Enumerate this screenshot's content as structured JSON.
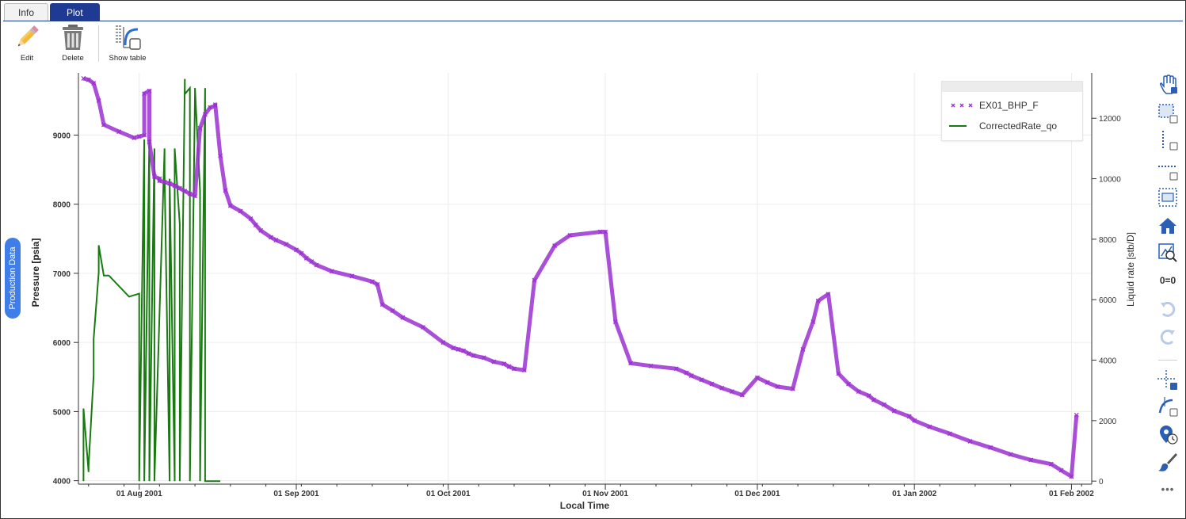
{
  "tabs": [
    {
      "label": "Info",
      "active": false
    },
    {
      "label": "Plot",
      "active": true
    }
  ],
  "toolbar": {
    "edit_label": "Edit",
    "delete_label": "Delete",
    "show_table_label": "Show table"
  },
  "side_tab": {
    "label": "Production Data"
  },
  "right_toolbar": {
    "icons": [
      "pan-icon",
      "box-zoom-icon",
      "x-zoom-icon",
      "y-zoom-icon",
      "zoom-both-icon",
      "reset-home-icon",
      "zoom-to-fit-icon",
      "zero-zero-icon",
      "undo-icon",
      "redo-icon",
      "crosshair-icon",
      "curve-select-icon",
      "hover-tooltip-icon",
      "paint-brush-icon",
      "more-icon"
    ],
    "zero_label": "0=0",
    "more_label": "•••"
  },
  "colors": {
    "accent": "#1f3a93",
    "pressure_series": "#9b30d0",
    "rate_series": "#1a7a12",
    "side_pill": "#3f7ee8"
  },
  "chart_data": {
    "type": "line",
    "xlabel": "Local Time",
    "ylabel": "Pressure [psia]",
    "y2label": "Liquid rate [stb/D]",
    "xlim": [
      "2001-07-20",
      "2002-02-05"
    ],
    "ylim": [
      3950,
      9900
    ],
    "y2lim": [
      -100,
      13500
    ],
    "x_ticks": [
      {
        "date": "2001-08-01",
        "label": "01 Aug 2001"
      },
      {
        "date": "2001-09-01",
        "label": "01 Sep 2001"
      },
      {
        "date": "2001-10-01",
        "label": "01 Oct 2001"
      },
      {
        "date": "2001-11-01",
        "label": "01 Nov 2001"
      },
      {
        "date": "2001-12-01",
        "label": "01 Dec 2001"
      },
      {
        "date": "2002-01-01",
        "label": "01 Jan 2002"
      },
      {
        "date": "2002-02-01",
        "label": "01 Feb 2002"
      }
    ],
    "y_ticks": [
      4000,
      5000,
      6000,
      7000,
      8000,
      9000
    ],
    "y2_ticks": [
      0,
      2000,
      4000,
      6000,
      8000,
      10000,
      12000
    ],
    "grid": true,
    "legend_position": "top-right",
    "series": [
      {
        "name": "EX01_BHP_F",
        "axis": "left",
        "style": "x-markers",
        "x": [
          "2001-07-21",
          "2001-07-22",
          "2001-07-23",
          "2001-07-24",
          "2001-07-25",
          "2001-07-28",
          "2001-07-31",
          "2001-08-01",
          "2001-08-02",
          "2001-08-02",
          "2001-08-03",
          "2001-08-03",
          "2001-08-04",
          "2001-08-05",
          "2001-08-05",
          "2001-08-06",
          "2001-08-07",
          "2001-08-08",
          "2001-08-09",
          "2001-08-10",
          "2001-08-11",
          "2001-08-12",
          "2001-08-13",
          "2001-08-14",
          "2001-08-15",
          "2001-08-16",
          "2001-08-16",
          "2001-08-17",
          "2001-08-18",
          "2001-08-19",
          "2001-08-21",
          "2001-08-23",
          "2001-08-24",
          "2001-08-25",
          "2001-08-27",
          "2001-08-28",
          "2001-08-30",
          "2001-09-01",
          "2001-09-02",
          "2001-09-03",
          "2001-09-04",
          "2001-09-05",
          "2001-09-08",
          "2001-09-12",
          "2001-09-16",
          "2001-09-17",
          "2001-09-18",
          "2001-09-20",
          "2001-09-22",
          "2001-09-26",
          "2001-09-30",
          "2001-10-02",
          "2001-10-03",
          "2001-10-04",
          "2001-10-05",
          "2001-10-06",
          "2001-10-08",
          "2001-10-10",
          "2001-10-12",
          "2001-10-13",
          "2001-10-14",
          "2001-10-16",
          "2001-10-18",
          "2001-10-22",
          "2001-10-25",
          "2001-10-31",
          "2001-11-01",
          "2001-11-03",
          "2001-11-06",
          "2001-11-10",
          "2001-11-15",
          "2001-11-17",
          "2001-11-18",
          "2001-11-20",
          "2001-11-22",
          "2001-11-24",
          "2001-11-26",
          "2001-11-28",
          "2001-12-01",
          "2001-12-03",
          "2001-12-05",
          "2001-12-08",
          "2001-12-10",
          "2001-12-12",
          "2001-12-13",
          "2001-12-15",
          "2001-12-17",
          "2001-12-19",
          "2001-12-21",
          "2001-12-23",
          "2001-12-24",
          "2001-12-26",
          "2001-12-28",
          "2001-12-31",
          "2002-01-01",
          "2002-01-04",
          "2002-01-08",
          "2002-01-12",
          "2002-01-16",
          "2002-01-20",
          "2002-01-24",
          "2002-01-28",
          "2002-01-30",
          "2002-02-01",
          "2002-02-02"
        ],
        "y": [
          9820,
          9800,
          9750,
          9500,
          9150,
          9050,
          8960,
          8980,
          9000,
          9600,
          9640,
          8900,
          8400,
          8370,
          8340,
          8320,
          8300,
          8270,
          8230,
          8190,
          8150,
          8120,
          9100,
          9300,
          9400,
          9420,
          9440,
          8700,
          8200,
          7980,
          7900,
          7790,
          7700,
          7620,
          7520,
          7480,
          7420,
          7340,
          7290,
          7220,
          7170,
          7120,
          7030,
          6960,
          6880,
          6840,
          6550,
          6460,
          6360,
          6220,
          6000,
          5920,
          5900,
          5880,
          5840,
          5810,
          5780,
          5720,
          5690,
          5650,
          5620,
          5600,
          6900,
          7400,
          7550,
          7600,
          7600,
          6300,
          5700,
          5660,
          5620,
          5560,
          5520,
          5460,
          5400,
          5340,
          5290,
          5240,
          5490,
          5420,
          5360,
          5330,
          5900,
          6300,
          6600,
          6700,
          5550,
          5400,
          5290,
          5230,
          5170,
          5100,
          5010,
          4930,
          4870,
          4780,
          4680,
          4570,
          4480,
          4380,
          4300,
          4240,
          4150,
          4060,
          4950
        ]
      },
      {
        "name": "CorrectedRate_qo",
        "axis": "right",
        "style": "step-line",
        "x": [
          "2001-07-21",
          "2001-07-21",
          "2001-07-22",
          "2001-07-22",
          "2001-07-23",
          "2001-07-23",
          "2001-07-24",
          "2001-07-24",
          "2001-07-25",
          "2001-07-25",
          "2001-07-26",
          "2001-07-26",
          "2001-07-30",
          "2001-07-30",
          "2001-08-01",
          "2001-08-01",
          "2001-08-02",
          "2001-08-02",
          "2001-08-03",
          "2001-08-03",
          "2001-08-04",
          "2001-08-04",
          "2001-08-06",
          "2001-08-06",
          "2001-08-07",
          "2001-08-07",
          "2001-08-08",
          "2001-08-08",
          "2001-08-09",
          "2001-08-09",
          "2001-08-10",
          "2001-08-10",
          "2001-08-11",
          "2001-08-11",
          "2001-08-12",
          "2001-08-12",
          "2001-08-13",
          "2001-08-13",
          "2001-08-14",
          "2001-08-14",
          "2001-08-15",
          "2001-08-15",
          "2001-08-16",
          "2001-08-16",
          "2001-08-17"
        ],
        "y": [
          0,
          2400,
          300,
          500,
          3500,
          4700,
          6900,
          7800,
          6800,
          6800,
          6800,
          6800,
          6100,
          6100,
          6200,
          0,
          11300,
          0,
          11300,
          0,
          11000,
          0,
          11000,
          10200,
          0,
          10000,
          0,
          11000,
          8500,
          0,
          13300,
          12800,
          13000,
          0,
          12800,
          13000,
          9600,
          0,
          13000,
          0,
          0,
          0,
          0,
          0,
          0
        ]
      }
    ]
  }
}
